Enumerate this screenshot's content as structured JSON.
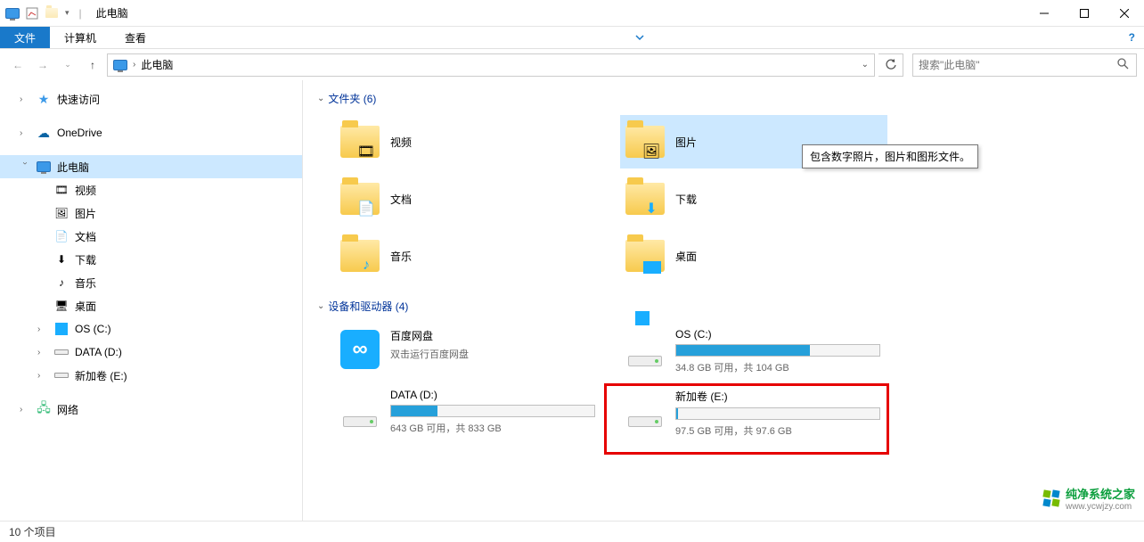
{
  "titlebar": {
    "title": "此电脑",
    "separator": "|"
  },
  "ribbon": {
    "file": "文件",
    "computer": "计算机",
    "view": "查看"
  },
  "nav": {
    "address_location": "此电脑",
    "search_placeholder": "搜索\"此电脑\""
  },
  "sidebar": {
    "quick_access": "快速访问",
    "onedrive": "OneDrive",
    "this_pc": "此电脑",
    "videos": "视频",
    "pictures": "图片",
    "documents": "文档",
    "downloads": "下载",
    "music": "音乐",
    "desktop": "桌面",
    "os_c": "OS (C:)",
    "data_d": "DATA (D:)",
    "new_e": "新加卷 (E:)",
    "network": "网络"
  },
  "content": {
    "folders_header": "文件夹 (6)",
    "devices_header": "设备和驱动器 (4)",
    "folders": {
      "videos": "视频",
      "pictures": "图片",
      "documents": "文档",
      "downloads": "下载",
      "music": "音乐",
      "desktop": "桌面"
    },
    "tooltip": "包含数字照片，图片和图形文件。",
    "baidu": {
      "name": "百度网盘",
      "subtitle": "双击运行百度网盘"
    },
    "drives": {
      "os": {
        "name": "OS (C:)",
        "status": "34.8 GB 可用，共 104 GB",
        "fill_pct": 66
      },
      "data": {
        "name": "DATA (D:)",
        "status": "643 GB 可用，共 833 GB",
        "fill_pct": 23
      },
      "new": {
        "name": "新加卷 (E:)",
        "status": "97.5 GB 可用，共 97.6 GB",
        "fill_pct": 1
      }
    }
  },
  "statusbar": {
    "items": "10 个项目"
  },
  "watermark": {
    "title": "纯净系统之家",
    "url": "www.ycwjzy.com"
  }
}
